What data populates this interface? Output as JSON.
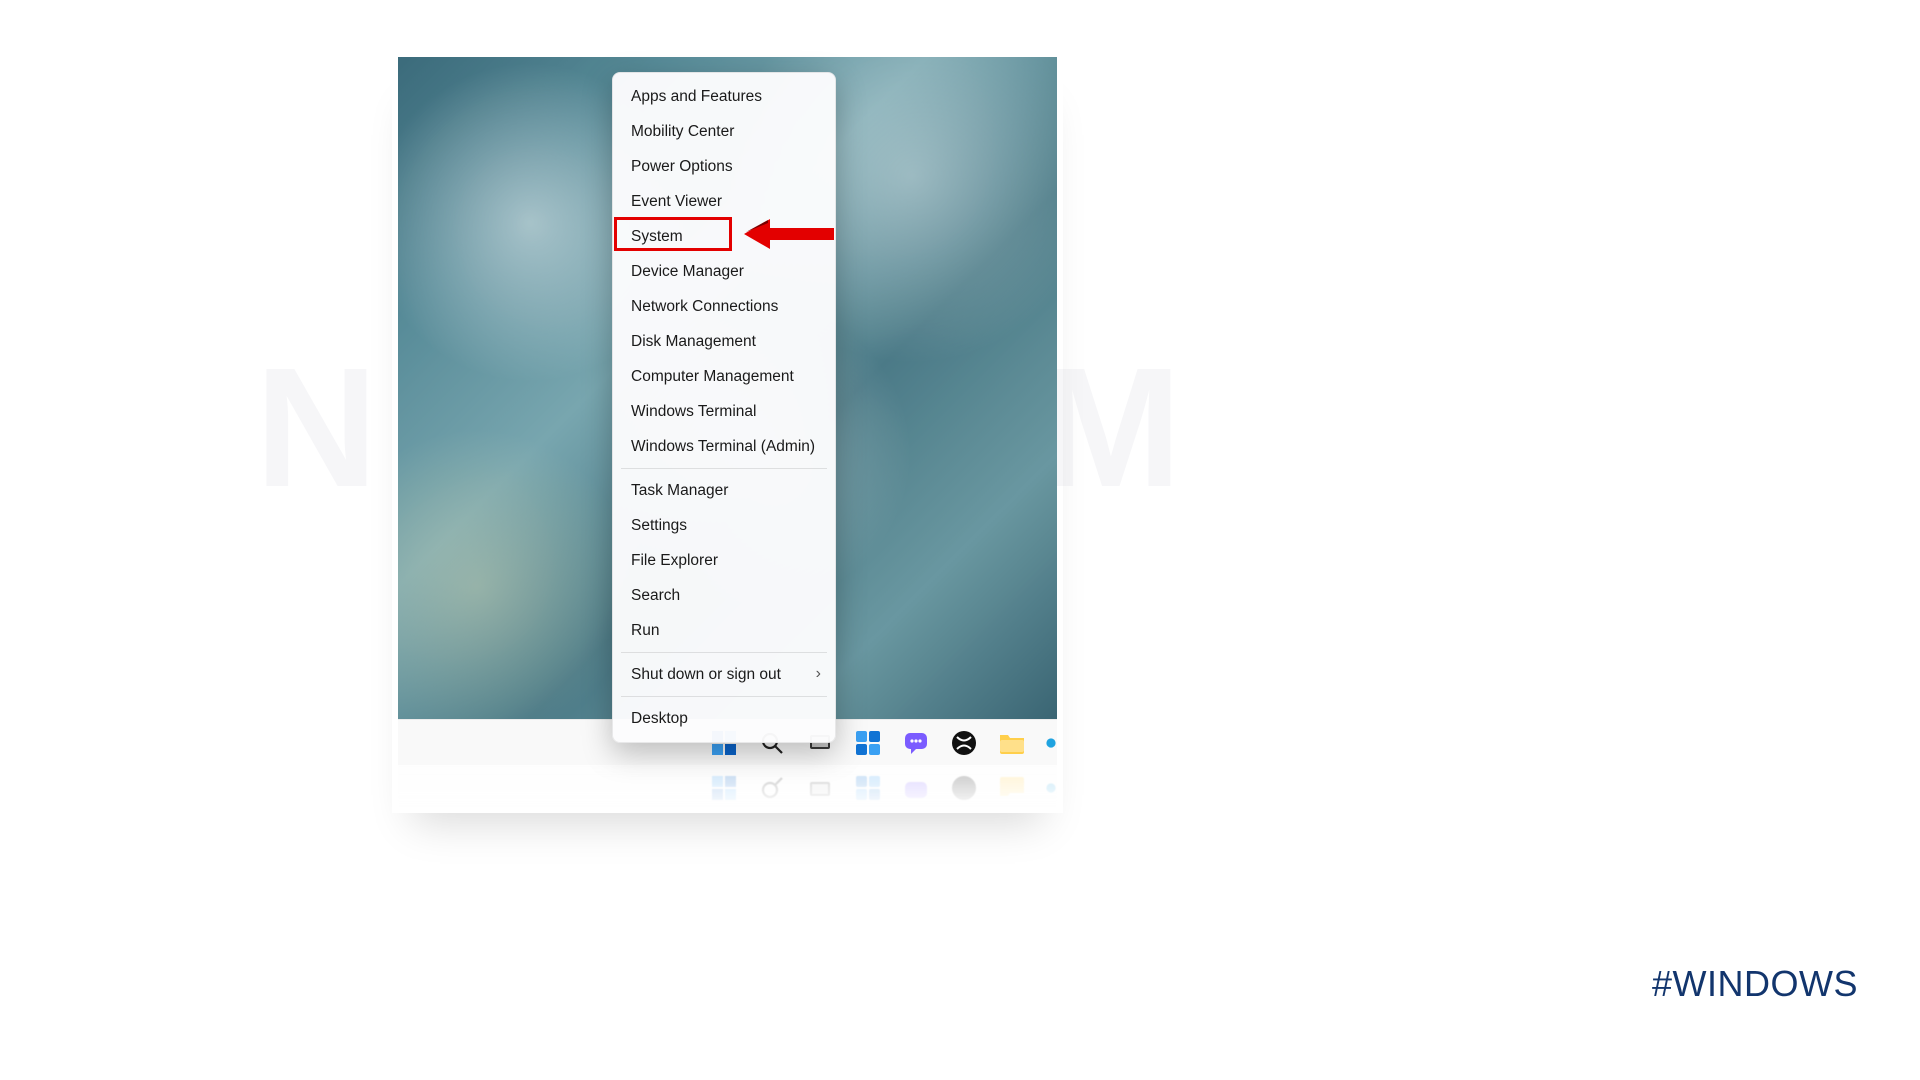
{
  "hashtag": "#WINDOWS",
  "watermark_left": "N",
  "watermark_right": "M",
  "context_menu": {
    "items": [
      {
        "label": "Apps and Features",
        "highlighted": false,
        "submenu": false
      },
      {
        "label": "Mobility Center",
        "highlighted": false,
        "submenu": false
      },
      {
        "label": "Power Options",
        "highlighted": false,
        "submenu": false
      },
      {
        "label": "Event Viewer",
        "highlighted": false,
        "submenu": false
      },
      {
        "label": "System",
        "highlighted": true,
        "submenu": false
      },
      {
        "label": "Device Manager",
        "highlighted": false,
        "submenu": false
      },
      {
        "label": "Network Connections",
        "highlighted": false,
        "submenu": false
      },
      {
        "label": "Disk Management",
        "highlighted": false,
        "submenu": false
      },
      {
        "label": "Computer Management",
        "highlighted": false,
        "submenu": false
      },
      {
        "label": "Windows Terminal",
        "highlighted": false,
        "submenu": false
      },
      {
        "label": "Windows Terminal (Admin)",
        "highlighted": false,
        "submenu": false
      }
    ],
    "items2": [
      {
        "label": "Task Manager",
        "highlighted": false,
        "submenu": false
      },
      {
        "label": "Settings",
        "highlighted": false,
        "submenu": false
      },
      {
        "label": "File Explorer",
        "highlighted": false,
        "submenu": false
      },
      {
        "label": "Search",
        "highlighted": false,
        "submenu": false
      },
      {
        "label": "Run",
        "highlighted": false,
        "submenu": false
      }
    ],
    "items3": [
      {
        "label": "Shut down or sign out",
        "highlighted": false,
        "submenu": true
      }
    ],
    "items4": [
      {
        "label": "Desktop",
        "highlighted": false,
        "submenu": false
      }
    ]
  },
  "taskbar": {
    "icons": [
      "start-icon",
      "search-icon",
      "task-view-icon",
      "widgets-icon",
      "chat-icon",
      "xbox-icon",
      "file-explorer-icon",
      "edge-icon"
    ]
  },
  "colors": {
    "accent_blue": "#0a63c9",
    "highlight_red": "#e30000"
  }
}
